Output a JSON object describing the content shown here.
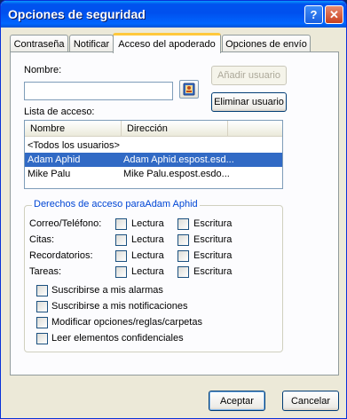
{
  "window": {
    "title": "Opciones de seguridad",
    "help_glyph": "?",
    "close_glyph": "✕"
  },
  "tabs": [
    {
      "label": "Contraseña"
    },
    {
      "label": "Notificar"
    },
    {
      "label": "Acceso del apoderado",
      "active": true
    },
    {
      "label": "Opciones de envío"
    }
  ],
  "delegate": {
    "name_label": "Nombre:",
    "name_value": "",
    "add_button": "Añadir usuario",
    "remove_button": "Eliminar usuario",
    "access_list_label": "Lista de acceso:",
    "columns": [
      "Nombre",
      "Dirección"
    ],
    "rows": [
      {
        "name": "<Todos los usuarios>",
        "address": "",
        "selected": false
      },
      {
        "name": "Adam Aphid",
        "address": "Adam Aphid.espost.esd...",
        "selected": true
      },
      {
        "name": "Mike Palu",
        "address": "Mike Palu.espost.esdo...",
        "selected": false
      }
    ]
  },
  "rights": {
    "group_title": "Derechos de acceso paraAdam Aphid",
    "read_label": "Lectura",
    "write_label": "Escritura",
    "items": [
      {
        "label": "Correo/Teléfono:",
        "read": false,
        "write": false
      },
      {
        "label": "Citas:",
        "read": false,
        "write": false
      },
      {
        "label": "Recordatorios:",
        "read": false,
        "write": false
      },
      {
        "label": "Tareas:",
        "read": false,
        "write": false
      }
    ],
    "options": [
      {
        "label": "Suscribirse a mis alarmas",
        "checked": false
      },
      {
        "label": "Suscribirse a mis notificaciones",
        "checked": false
      },
      {
        "label": "Modificar opciones/reglas/carpetas",
        "checked": false
      },
      {
        "label": "Leer elementos confidenciales",
        "checked": false
      }
    ]
  },
  "footer": {
    "ok": "Aceptar",
    "cancel": "Cancelar"
  },
  "icons": {
    "address_book": "address-book-icon"
  }
}
